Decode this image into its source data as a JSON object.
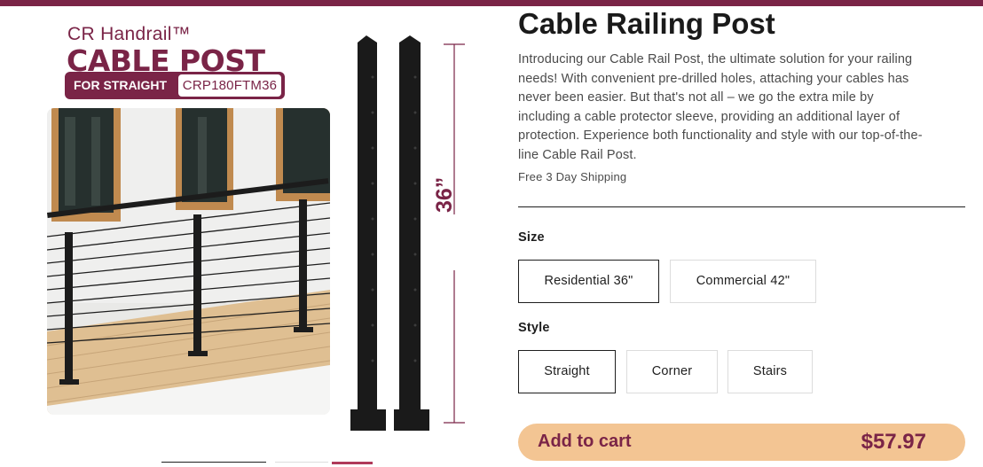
{
  "brand": {
    "subtitle": "CR Handrail™",
    "headline": "CABLE POST",
    "tag_label": "FOR STRAIGHT",
    "tag_code": "CRP180FTM36",
    "dimension_label": "36”"
  },
  "product": {
    "title": "Cable Railing Post",
    "description": "Introducing our Cable Rail Post, the ultimate solution for your railing needs! With convenient pre-drilled holes, attaching your cables has never been easier. But that's not all – we go the extra mile by including a cable protector sleeve, providing an additional layer of protection. Experience both functionality and style with our top-of-the-line Cable Rail Post.",
    "shipping": "Free 3 Day Shipping"
  },
  "size": {
    "label": "Size",
    "options": [
      "Residential 36\"",
      "Commercial 42\""
    ],
    "selected": "Residential 36\""
  },
  "style": {
    "label": "Style",
    "options": [
      "Straight",
      "Corner",
      "Stairs"
    ],
    "selected": "Straight"
  },
  "cart": {
    "label": "Add to cart",
    "price": "$57.97"
  },
  "colors": {
    "brand": "#7a2447",
    "cart_bg": "#f3c593"
  }
}
